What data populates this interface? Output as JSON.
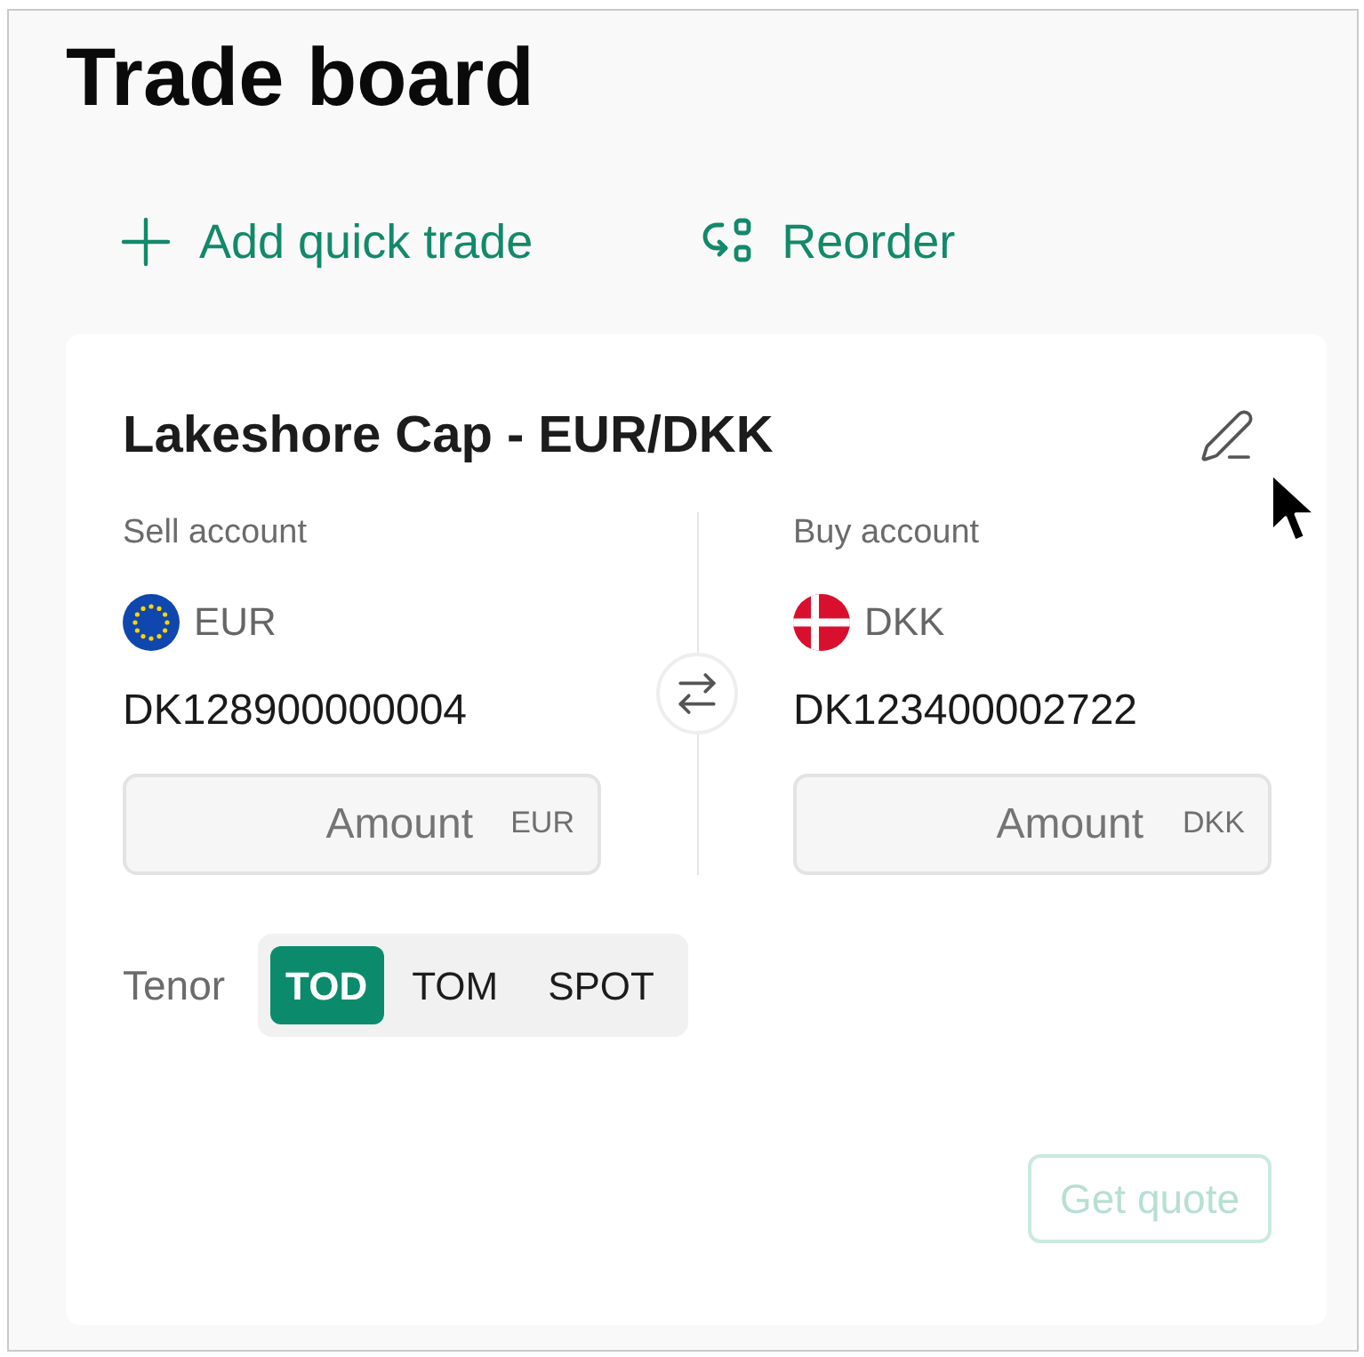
{
  "page": {
    "title": "Trade board"
  },
  "actions": [
    {
      "kind": "add",
      "label": "Add quick trade"
    },
    {
      "kind": "reorder",
      "label": "Reorder"
    }
  ],
  "card": {
    "title": "Lakeshore Cap - EUR/DKK",
    "accounts": [
      {
        "label": "Sell account",
        "kind": "eu",
        "currency": "EUR",
        "account_number": "DK128900000004",
        "amount": {
          "placeholder": "Amount",
          "currency": "EUR"
        }
      },
      {
        "label": "Buy account",
        "kind": "dk",
        "currency": "DKK",
        "account_number": "DK123400002722",
        "amount": {
          "placeholder": "Amount",
          "currency": "DKK"
        }
      }
    ],
    "tenor": {
      "label": "Tenor",
      "options": [
        {
          "label": "TOD",
          "selected": true
        },
        {
          "label": "TOM",
          "selected": false
        },
        {
          "label": "SPOT",
          "selected": false
        }
      ]
    },
    "get_quote": {
      "label": "Get quote",
      "disabled": true
    }
  }
}
